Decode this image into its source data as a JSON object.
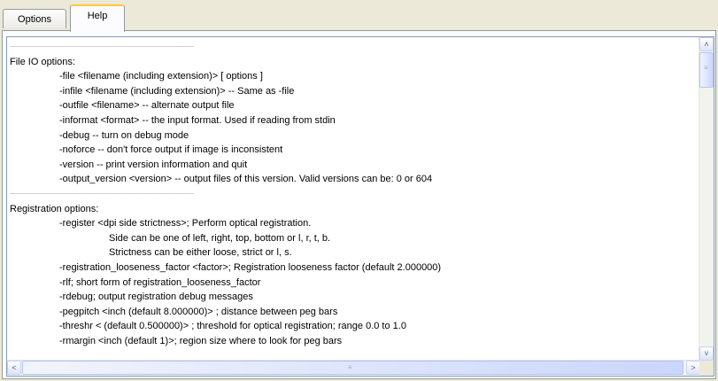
{
  "tabs": [
    {
      "label": "Options",
      "selected": false
    },
    {
      "label": "Help",
      "selected": true
    }
  ],
  "help_lines": [
    {
      "level": 0,
      "text": "--------------------------------------------------------------------------------------------------------",
      "separator": true
    },
    {
      "level": 0,
      "text": "File IO options:"
    },
    {
      "level": 1,
      "text": "-file <filename (including extension)> [ options ]"
    },
    {
      "level": 1,
      "text": "-infile <filename (including extension)> -- Same as -file"
    },
    {
      "level": 1,
      "text": "-outfile <filename> -- alternate output file"
    },
    {
      "level": 1,
      "text": "-informat <format> -- the input format. Used if reading from stdin"
    },
    {
      "level": 1,
      "text": "-debug -- turn on debug mode"
    },
    {
      "level": 1,
      "text": "-noforce -- don't force output if image is inconsistent"
    },
    {
      "level": 1,
      "text": "-version -- print version information and quit"
    },
    {
      "level": 1,
      "text": "-output_version <version> -- output files of this version. Valid versions can be: 0 or 604"
    },
    {
      "level": 0,
      "text": "--------------------------------------------------------------------------------------------------------",
      "separator": true
    },
    {
      "level": 0,
      "text": "Registration options:"
    },
    {
      "level": 1,
      "text": "-register <dpi side strictness>; Perform optical registration."
    },
    {
      "level": 2,
      "text": "Side can be one of left, right, top, bottom or l, r, t, b."
    },
    {
      "level": 2,
      "text": "Strictness can be either loose, strict or l, s."
    },
    {
      "level": 1,
      "text": "-registration_looseness_factor <factor>; Registration looseness factor (default 2.000000)"
    },
    {
      "level": 1,
      "text": "-rlf; short form of registration_looseness_factor"
    },
    {
      "level": 1,
      "text": "-rdebug; output registration debug messages"
    },
    {
      "level": 1,
      "text": "-pegpitch <inch (default 8.000000)> ; distance between peg bars"
    },
    {
      "level": 1,
      "text": "-threshr < (default 0.500000)> ; threshold for optical registration; range 0.0 to 1.0"
    },
    {
      "level": 1,
      "text": "-rmargin <inch (default 1)>; region size where to look for peg bars"
    }
  ],
  "scroll": {
    "up_arrow": "˄",
    "down_arrow": "˅",
    "left_arrow": "<",
    "right_arrow": ">",
    "grip": "≡"
  }
}
